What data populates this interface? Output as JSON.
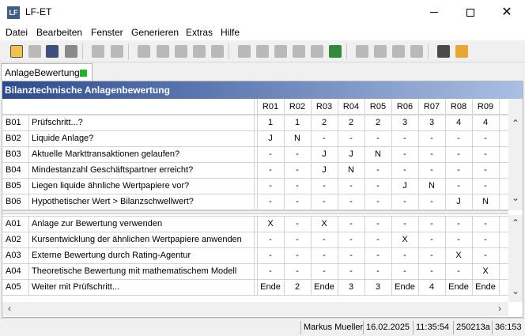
{
  "window": {
    "title": "LF-ET",
    "logo_text": "LF"
  },
  "menu": [
    "Datei",
    "Bearbeiten",
    "Fenster",
    "Generieren",
    "Extras",
    "Hilfe"
  ],
  "toolbar": {
    "buttons": [
      {
        "name": "open-file-icon",
        "style": "open",
        "state": "active"
      },
      {
        "name": "save-icon",
        "style": "dis",
        "state": "disabled"
      },
      {
        "name": "save-as-icon",
        "style": "saveas",
        "state": "enabled"
      },
      {
        "name": "print-icon",
        "style": "print",
        "state": "enabled"
      },
      {
        "name": "undo-icon",
        "style": "dis",
        "state": "disabled"
      },
      {
        "name": "find-icon",
        "style": "dis",
        "state": "disabled"
      },
      {
        "name": "cut-icon",
        "style": "dis",
        "state": "disabled"
      },
      {
        "name": "copy-icon",
        "style": "dis",
        "state": "disabled"
      },
      {
        "name": "paste-icon",
        "style": "dis",
        "state": "disabled"
      },
      {
        "name": "paste-special-icon",
        "style": "dis",
        "state": "disabled"
      },
      {
        "name": "delete-icon",
        "style": "dis",
        "state": "disabled"
      },
      {
        "name": "insert-row-icon",
        "style": "dis",
        "state": "disabled"
      },
      {
        "name": "insert-column-icon",
        "style": "dis",
        "state": "disabled"
      },
      {
        "name": "filter-icon",
        "style": "dis",
        "state": "disabled"
      },
      {
        "name": "table-icon",
        "style": "dis",
        "state": "disabled"
      },
      {
        "name": "grid-icon",
        "style": "dis",
        "state": "disabled"
      },
      {
        "name": "checklist-icon",
        "style": "green",
        "state": "enabled"
      },
      {
        "name": "arrow-up-icon",
        "style": "dis",
        "state": "disabled"
      },
      {
        "name": "arrow-down-icon",
        "style": "dis",
        "state": "disabled"
      },
      {
        "name": "arrow-left-icon",
        "style": "dis",
        "state": "disabled"
      },
      {
        "name": "arrow-right-icon",
        "style": "dis",
        "state": "disabled"
      },
      {
        "name": "camera-icon",
        "style": "camera",
        "state": "enabled"
      },
      {
        "name": "folder-image-icon",
        "style": "folder",
        "state": "enabled"
      }
    ]
  },
  "tab": {
    "label": "AnlageBewertung",
    "status_color": "#21b321"
  },
  "panel": {
    "title": "Bilanztechnische Anlagenbewertung"
  },
  "rules": [
    "R01",
    "R02",
    "R03",
    "R04",
    "R05",
    "R06",
    "R07",
    "R08",
    "R09"
  ],
  "conditions": [
    {
      "id": "B01",
      "text": "Prüfschritt...?",
      "values": [
        "1",
        "1",
        "2",
        "2",
        "2",
        "3",
        "3",
        "4",
        "4"
      ]
    },
    {
      "id": "B02",
      "text": "Liquide Anlage?",
      "values": [
        "J",
        "N",
        "-",
        "-",
        "-",
        "-",
        "-",
        "-",
        "-"
      ]
    },
    {
      "id": "B03",
      "text": "Aktuelle Markttransaktionen gelaufen?",
      "values": [
        "-",
        "-",
        "J",
        "J",
        "N",
        "-",
        "-",
        "-",
        "-"
      ]
    },
    {
      "id": "B04",
      "text": "Mindestanzahl Geschäftspartner erreicht?",
      "values": [
        "-",
        "-",
        "J",
        "N",
        "-",
        "-",
        "-",
        "-",
        "-"
      ]
    },
    {
      "id": "B05",
      "text": "Liegen liquide ähnliche Wertpapiere vor?",
      "values": [
        "-",
        "-",
        "-",
        "-",
        "-",
        "J",
        "N",
        "-",
        "-"
      ]
    },
    {
      "id": "B06",
      "text": "Hypothetischer Wert > Bilanzschwellwert?",
      "values": [
        "-",
        "-",
        "-",
        "-",
        "-",
        "-",
        "-",
        "J",
        "N"
      ]
    }
  ],
  "actions": [
    {
      "id": "A01",
      "text": "Anlage zur Bewertung verwenden",
      "values": [
        "X",
        "-",
        "X",
        "-",
        "-",
        "-",
        "-",
        "-",
        "-"
      ]
    },
    {
      "id": "A02",
      "text": "Kursentwicklung der ähnlichen Wertpapiere anwenden",
      "values": [
        "-",
        "-",
        "-",
        "-",
        "-",
        "X",
        "-",
        "-",
        "-"
      ]
    },
    {
      "id": "A03",
      "text": "Externe Bewertung durch Rating-Agentur",
      "values": [
        "-",
        "-",
        "-",
        "-",
        "-",
        "-",
        "-",
        "X",
        "-"
      ]
    },
    {
      "id": "A04",
      "text": "Theoretische Bewertung mit mathematischem Modell",
      "values": [
        "-",
        "-",
        "-",
        "-",
        "-",
        "-",
        "-",
        "-",
        "X"
      ]
    },
    {
      "id": "A05",
      "text": "Weiter mit Prüfschritt...",
      "values": [
        "Ende",
        "2",
        "Ende",
        "3",
        "3",
        "Ende",
        "4",
        "Ende",
        "Ende"
      ]
    }
  ],
  "status": {
    "user": "Markus Mueller",
    "date": "16.02.2025",
    "time": "11:35:54",
    "code": "250213a",
    "position": "36:153"
  }
}
